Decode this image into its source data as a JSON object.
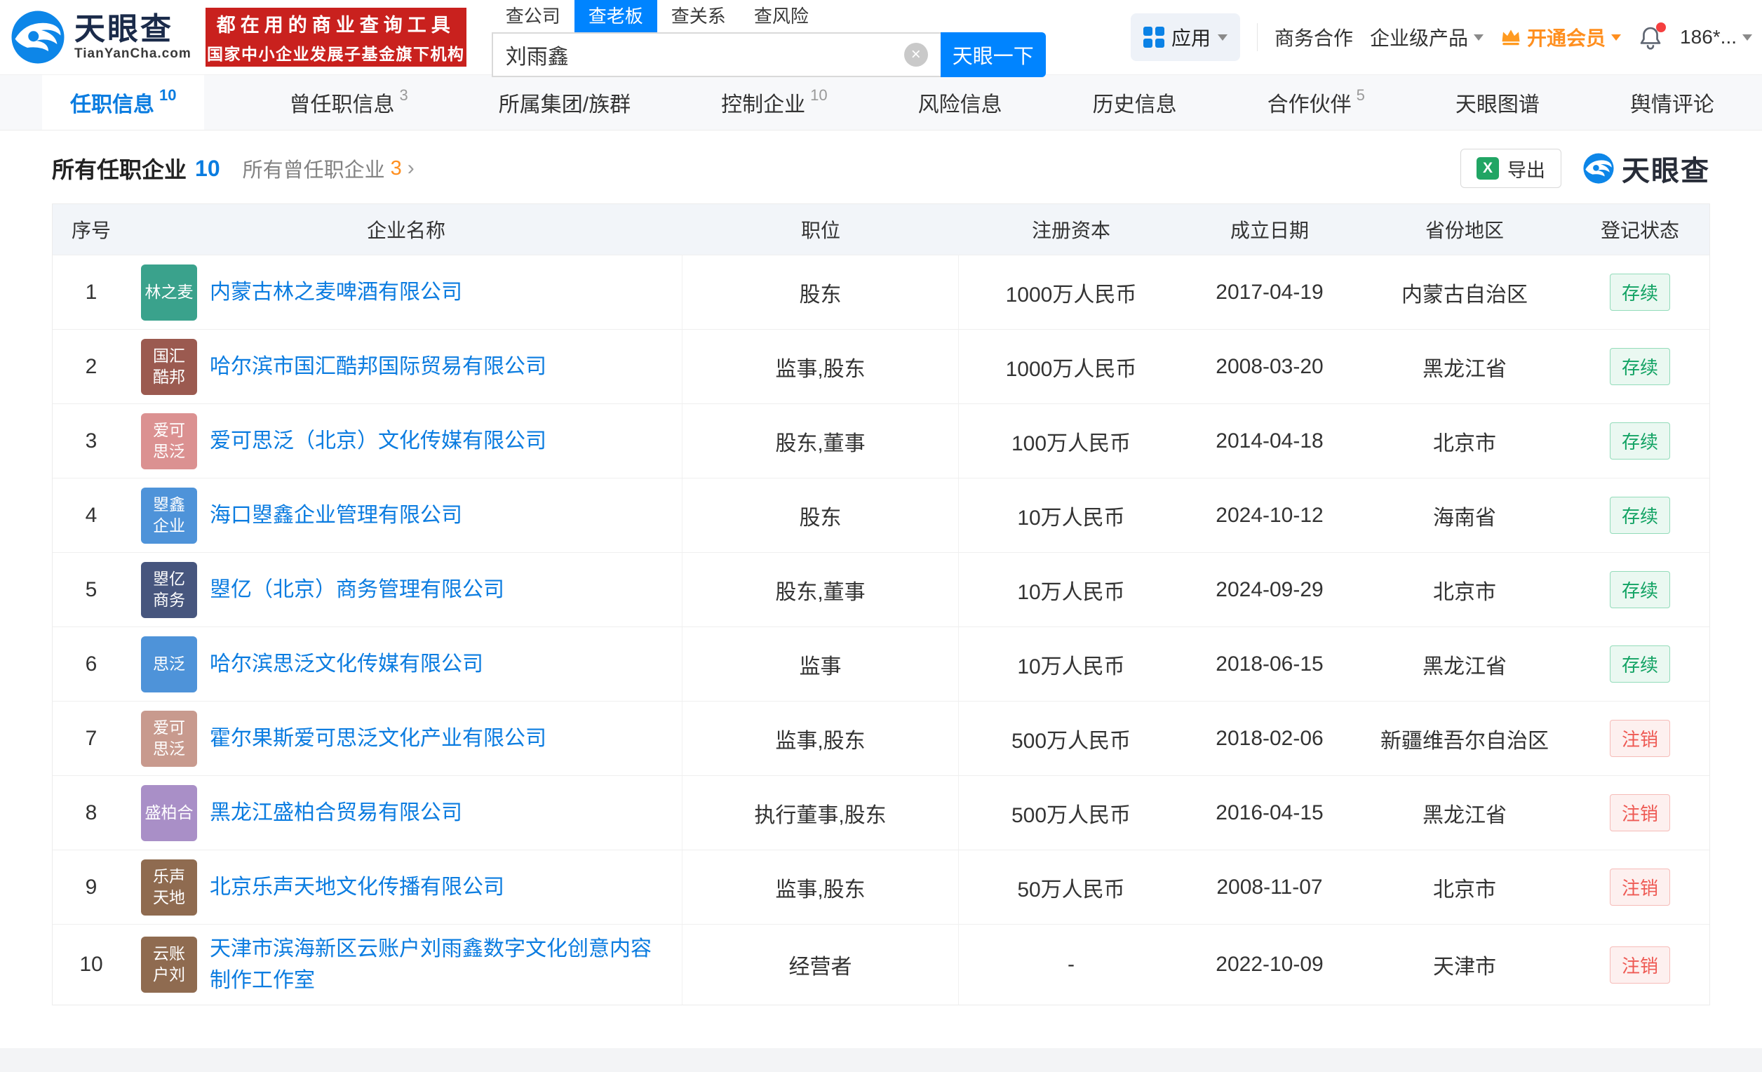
{
  "colors": {
    "brand_blue": "#0084ff",
    "banner_red": "#c9211e",
    "vip_orange": "#ff8f1f",
    "link_blue": "#0b7ce0",
    "status_active_green": "#13a364",
    "status_revoked_red": "#ee5a54"
  },
  "header": {
    "logo": {
      "brand": "天眼查",
      "domain": "TianYanCha.com"
    },
    "banner": {
      "line1": "都在用的商业查询工具",
      "line2": "国家中小企业发展子基金旗下机构"
    },
    "search": {
      "tabs": [
        {
          "label": "查公司",
          "active": false
        },
        {
          "label": "查老板",
          "active": true
        },
        {
          "label": "查关系",
          "active": false
        },
        {
          "label": "查风险",
          "active": false
        }
      ],
      "value": "刘雨鑫",
      "clear_icon": "×",
      "button_label": "天眼一下"
    },
    "right": {
      "apps_label": "应用",
      "link_business": "商务合作",
      "link_enterprise": "企业级产品",
      "vip_label": "开通会员",
      "account_label": "186*..."
    }
  },
  "nav_tabs": [
    {
      "label": "任职信息",
      "count": "10",
      "active": true
    },
    {
      "label": "曾任职信息",
      "count": "3",
      "active": false
    },
    {
      "label": "所属集团/族群",
      "count": "",
      "active": false
    },
    {
      "label": "控制企业",
      "count": "10",
      "active": false
    },
    {
      "label": "风险信息",
      "count": "",
      "active": false
    },
    {
      "label": "历史信息",
      "count": "",
      "active": false
    },
    {
      "label": "合作伙伴",
      "count": "5",
      "active": false
    },
    {
      "label": "天眼图谱",
      "count": "",
      "active": false
    },
    {
      "label": "舆情评论",
      "count": "",
      "active": false
    }
  ],
  "section": {
    "title": "所有任职企业",
    "title_count": "10",
    "subtitle": "所有曾任职企业",
    "subtitle_count": "3",
    "chevron": "›",
    "export_label": "导出",
    "brand_label": "天眼查"
  },
  "table": {
    "headers": [
      "序号",
      "企业名称",
      "职位",
      "注册资本",
      "成立日期",
      "省份地区",
      "登记状态"
    ],
    "rows": [
      {
        "no": "1",
        "logo_lines": [
          "林之麦"
        ],
        "logo_color": "#3aa28c",
        "company": "内蒙古林之麦啤酒有限公司",
        "position": "股东",
        "capital": "1000万人民币",
        "date": "2017-04-19",
        "region": "内蒙古自治区",
        "status": "存续",
        "status_type": "active"
      },
      {
        "no": "2",
        "logo_lines": [
          "国汇",
          "酷邦"
        ],
        "logo_color": "#9b5a50",
        "company": "哈尔滨市国汇酷邦国际贸易有限公司",
        "position": "监事,股东",
        "capital": "1000万人民币",
        "date": "2008-03-20",
        "region": "黑龙江省",
        "status": "存续",
        "status_type": "active"
      },
      {
        "no": "3",
        "logo_lines": [
          "爱可",
          "思泛"
        ],
        "logo_color": "#db9191",
        "company": "爱可思泛（北京）文化传媒有限公司",
        "position": "股东,董事",
        "capital": "100万人民币",
        "date": "2014-04-18",
        "region": "北京市",
        "status": "存续",
        "status_type": "active"
      },
      {
        "no": "4",
        "logo_lines": [
          "曌鑫",
          "企业"
        ],
        "logo_color": "#4e93d9",
        "company": "海口曌鑫企业管理有限公司",
        "position": "股东",
        "capital": "10万人民币",
        "date": "2024-10-12",
        "region": "海南省",
        "status": "存续",
        "status_type": "active"
      },
      {
        "no": "5",
        "logo_lines": [
          "曌亿",
          "商务"
        ],
        "logo_color": "#47567e",
        "company": "曌亿（北京）商务管理有限公司",
        "position": "股东,董事",
        "capital": "10万人民币",
        "date": "2024-09-29",
        "region": "北京市",
        "status": "存续",
        "status_type": "active"
      },
      {
        "no": "6",
        "logo_lines": [
          "思泛"
        ],
        "logo_color": "#4e93d9",
        "company": "哈尔滨思泛文化传媒有限公司",
        "position": "监事",
        "capital": "10万人民币",
        "date": "2018-06-15",
        "region": "黑龙江省",
        "status": "存续",
        "status_type": "active"
      },
      {
        "no": "7",
        "logo_lines": [
          "爱可",
          "思泛"
        ],
        "logo_color": "#c89a8e",
        "company": "霍尔果斯爱可思泛文化产业有限公司",
        "position": "监事,股东",
        "capital": "500万人民币",
        "date": "2018-02-06",
        "region": "新疆维吾尔自治区",
        "status": "注销",
        "status_type": "revoked"
      },
      {
        "no": "8",
        "logo_lines": [
          "盛柏合"
        ],
        "logo_color": "#a98fc7",
        "company": "黑龙江盛柏合贸易有限公司",
        "position": "执行董事,股东",
        "capital": "500万人民币",
        "date": "2016-04-15",
        "region": "黑龙江省",
        "status": "注销",
        "status_type": "revoked"
      },
      {
        "no": "9",
        "logo_lines": [
          "乐声",
          "天地"
        ],
        "logo_color": "#8f6b50",
        "company": "北京乐声天地文化传播有限公司",
        "position": "监事,股东",
        "capital": "50万人民币",
        "date": "2008-11-07",
        "region": "北京市",
        "status": "注销",
        "status_type": "revoked"
      },
      {
        "no": "10",
        "logo_lines": [
          "云账",
          "户刘"
        ],
        "logo_color": "#8f6b50",
        "company": "天津市滨海新区云账户刘雨鑫数字文化创意内容制作工作室",
        "position": "经营者",
        "capital": "-",
        "date": "2022-10-09",
        "region": "天津市",
        "status": "注销",
        "status_type": "revoked"
      }
    ]
  }
}
